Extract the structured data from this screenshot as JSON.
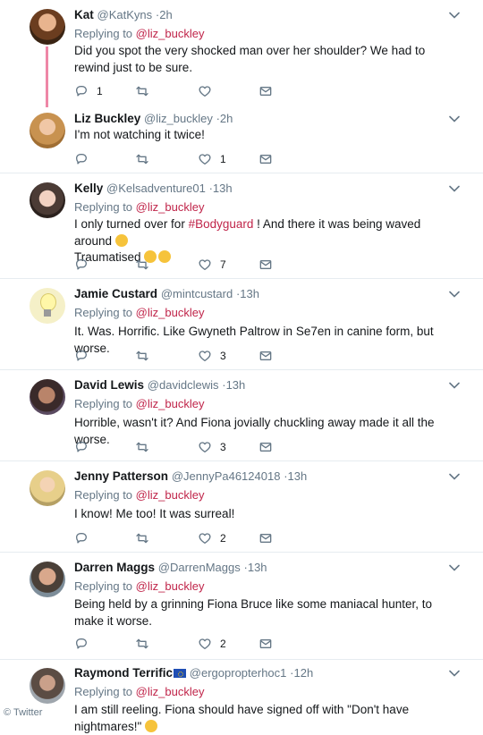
{
  "replying_to_label": "Replying to",
  "tweets": [
    {
      "name": "Kat",
      "handle": "@KatKyns",
      "time": "·2h",
      "mention": "@liz_buckley",
      "text": "Did you spot the very shocked man over her shoulder? We had to rewind just to be sure.",
      "replies": "1",
      "retweets": "",
      "likes": ""
    },
    {
      "name": "Liz Buckley",
      "handle": "@liz_buckley",
      "time": "·2h",
      "text": "I'm not watching it twice!",
      "replies": "",
      "retweets": "",
      "likes": "1"
    },
    {
      "name": "Kelly",
      "handle": "@Kelsadventure01",
      "time": "·13h",
      "mention": "@liz_buckley",
      "text_before": "I only turned over for ",
      "hashtag": "#Bodyguard",
      "text_after": " ! And there it was being waved around",
      "text_line2": "Traumatised",
      "replies": "",
      "retweets": "",
      "likes": "7"
    },
    {
      "name": "Jamie Custard",
      "handle": "@mintcustard",
      "time": "·13h",
      "mention": "@liz_buckley",
      "text": "It. Was. Horrific. Like Gwyneth Paltrow in Se7en in canine form, but worse.",
      "replies": "",
      "retweets": "",
      "likes": "3"
    },
    {
      "name": "David Lewis",
      "handle": "@davidclewis",
      "time": "·13h",
      "mention": "@liz_buckley",
      "text": "Horrible, wasn't it? And Fiona jovially chuckling away made it all the worse.",
      "replies": "",
      "retweets": "",
      "likes": "3"
    },
    {
      "name": "Jenny Patterson",
      "handle": "@JennyPa46124018",
      "time": "·13h",
      "mention": "@liz_buckley",
      "text": "I know! Me too! It was surreal!",
      "replies": "",
      "retweets": "",
      "likes": "2"
    },
    {
      "name": "Darren Maggs",
      "handle": "@DarrenMaggs",
      "time": "·13h",
      "mention": "@liz_buckley",
      "text": "Being held by a grinning Fiona Bruce like some maniacal hunter, to make it worse.",
      "replies": "",
      "retweets": "",
      "likes": "2"
    },
    {
      "name": "Raymond Terrific",
      "handle": "@ergopropterhoc1",
      "time": "·12h",
      "mention": "@liz_buckley",
      "text": "I am still reeling. Fiona should have signed off with \"Don't have nightmares!\"",
      "replies": "",
      "retweets": "",
      "likes": ""
    }
  ],
  "footer": "© Twitter",
  "colors": {
    "mention": "#c0254a",
    "icon": "#657786",
    "thread": "#e0245e"
  }
}
